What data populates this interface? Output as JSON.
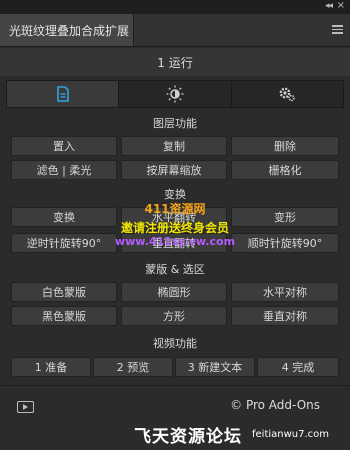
{
  "header": {
    "collapse_glyph": "◂◂",
    "close_glyph": "×",
    "tab_title": "光斑纹理叠加合成扩展",
    "panel_title": "1 运行"
  },
  "subtabs": [
    {
      "name": "document-icon",
      "active": true
    },
    {
      "name": "adjust-icon",
      "active": false
    },
    {
      "name": "settings-icon",
      "active": false
    }
  ],
  "layer": {
    "title": "图层功能",
    "row1": [
      "置入",
      "复制",
      "删除"
    ],
    "row2": [
      "滤色 | 柔光",
      "按屏幕缩放",
      "栅格化"
    ]
  },
  "transform": {
    "title": "变换",
    "row1": [
      "变换",
      "水平翻转",
      "变形"
    ],
    "row2": [
      "逆时针旋转90°",
      "垂直翻转",
      "顺时针旋转90°"
    ]
  },
  "mask": {
    "title": "蒙版 & 选区",
    "row1": [
      "白色蒙版",
      "椭圆形",
      "水平对称"
    ],
    "row2": [
      "黑色蒙版",
      "方形",
      "垂直对称"
    ]
  },
  "video": {
    "title": "视频功能",
    "buttons": [
      "1 准备",
      "2 预览",
      "3 新建文本",
      "4 完成"
    ]
  },
  "watermark": {
    "line1": "411资源网",
    "line2": "邀请注册送终身会员",
    "line3": "www.411sy.vw.com"
  },
  "footer": {
    "brand": "© Pro Add-Ons",
    "site_name": "飞天资源论坛",
    "site_url": "feitianwu7.com"
  },
  "colors": {
    "accent": "#2fa3e0",
    "background": "#2b2b2b",
    "button": "#3c3c3c"
  }
}
